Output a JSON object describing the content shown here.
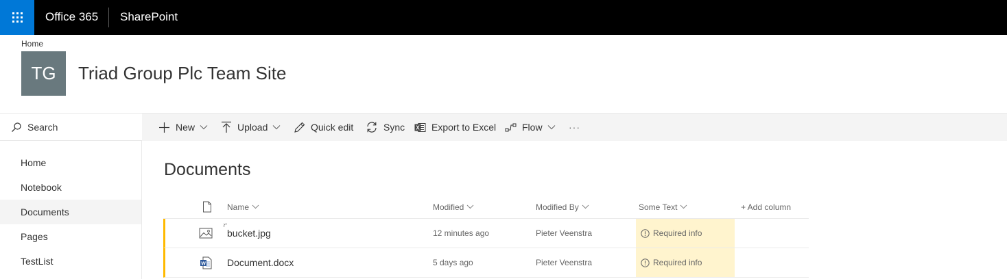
{
  "suite": {
    "brand": "Office 365",
    "app": "SharePoint"
  },
  "site": {
    "breadcrumb": "Home",
    "logo_initials": "TG",
    "title": "Triad Group Plc Team Site",
    "logo_color": "#69797e"
  },
  "search": {
    "label": "Search"
  },
  "commands": {
    "new": "New",
    "upload": "Upload",
    "quick_edit": "Quick edit",
    "sync": "Sync",
    "export": "Export to Excel",
    "flow": "Flow",
    "more": "···"
  },
  "nav": {
    "items": [
      "Home",
      "Notebook",
      "Documents",
      "Pages",
      "TestList"
    ],
    "selected": "Documents"
  },
  "library": {
    "title": "Documents",
    "columns": {
      "name": "Name",
      "modified": "Modified",
      "modified_by": "Modified By",
      "some_text": "Some Text",
      "add_column": "+ Add column"
    },
    "rows": [
      {
        "name": "bucket.jpg",
        "modified": "12 minutes ago",
        "modified_by": "Pieter Veenstra",
        "some_text": "Required info",
        "icon": "image-file-icon"
      },
      {
        "name": "Document.docx",
        "modified": "5 days ago",
        "modified_by": "Pieter Veenstra",
        "some_text": "Required info",
        "icon": "word-doc-icon"
      }
    ]
  },
  "colors": {
    "accent": "#0078d7",
    "warning_row": "#ffb900",
    "required_bg": "#fff4ce"
  }
}
